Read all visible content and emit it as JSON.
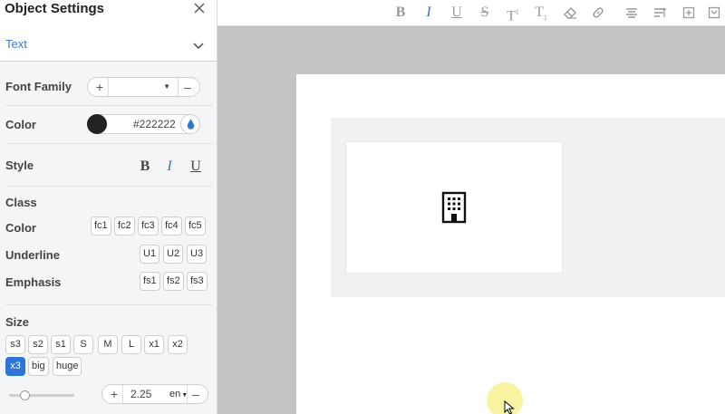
{
  "panel": {
    "title": "Object Settings",
    "type_select": {
      "value": "Text"
    },
    "font_family": {
      "label": "Font Family",
      "plus": "+",
      "minus": "–",
      "value": ""
    },
    "color": {
      "label": "Color",
      "value": "#222222",
      "swatch": "#222222"
    },
    "style": {
      "label": "Style",
      "bold": "B",
      "italic": "I",
      "underline": "U"
    },
    "class": {
      "heading": "Class",
      "color_label": "Color",
      "color_options": [
        "fc1",
        "fc2",
        "fc3",
        "fc4",
        "fc5"
      ],
      "underline_label": "Underline",
      "underline_options": [
        "U1",
        "U2",
        "U3"
      ],
      "emphasis_label": "Emphasis",
      "emphasis_options": [
        "fs1",
        "fs2",
        "fs3"
      ]
    },
    "size": {
      "label": "Size",
      "options": [
        "s3",
        "s2",
        "s1",
        "S",
        "M",
        "L",
        "x1",
        "x2",
        "x3",
        "big",
        "huge"
      ],
      "selected": "x3",
      "value": "2.25",
      "unit": "en",
      "plus": "+",
      "minus": "–",
      "slider_level": 0.2
    }
  },
  "toolbar": {
    "items": [
      "bold-icon",
      "italic-icon",
      "underline-icon",
      "strikethrough-icon",
      "superscript-icon",
      "subscript-icon",
      "eraser-icon",
      "link-icon",
      "align-icon",
      "text-size-icon",
      "insert-icon",
      "more-icon"
    ],
    "active": "italic-icon",
    "bold": "B",
    "italic": "I",
    "underline": "U",
    "strike": "S",
    "sup": "T",
    "sub": "T"
  },
  "canvas": {
    "icon": "building-icon"
  },
  "accent": "#2e76d6"
}
